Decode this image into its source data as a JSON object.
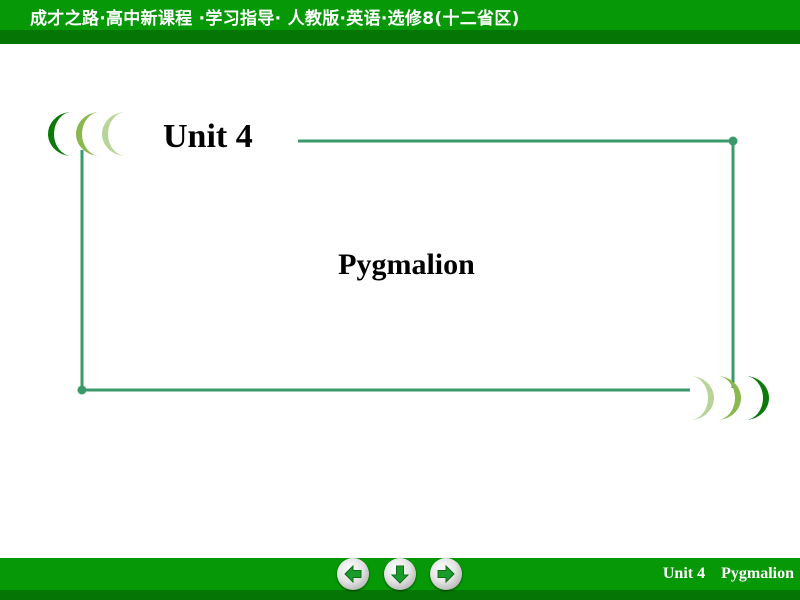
{
  "header": {
    "title": "成才之路·高中新课程 ·学习指导· 人教版·英语·选修8(十二省区)"
  },
  "slide": {
    "unit_title": "Unit 4",
    "lesson_title": "Pygmalion"
  },
  "footer": {
    "label": "Unit 4    Pygmalion",
    "nav": [
      {
        "icon": "arrow-left-icon",
        "action": "previous"
      },
      {
        "icon": "arrow-down-icon",
        "action": "home"
      },
      {
        "icon": "arrow-right-icon",
        "action": "next"
      }
    ]
  },
  "colors": {
    "bar_green": "#069806",
    "bar_dark_green": "#057605",
    "frame_line": "#3a9a6a",
    "crescent_dark": "#0b7a0b",
    "crescent_mid": "#8ab84e",
    "crescent_light": "#b8d49a"
  }
}
